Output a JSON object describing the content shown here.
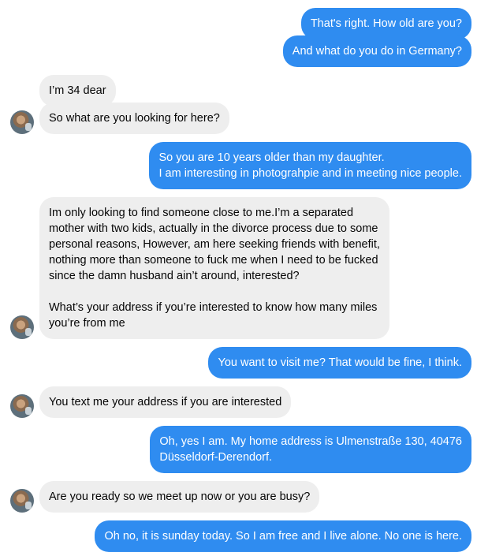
{
  "conversation": {
    "messages": [
      {
        "sender": "me",
        "text": "That's right. How old are you?"
      },
      {
        "sender": "me",
        "text": "And what do you do in Germany?"
      },
      {
        "sender": "them",
        "text": "I’m 34 dear"
      },
      {
        "sender": "them",
        "text": "So what are you looking for here?"
      },
      {
        "sender": "me",
        "text": "So you are 10 years older than my daughter.\nI am interesting in photograhpie and in meeting nice people."
      },
      {
        "sender": "them",
        "text": "Im only looking to find someone close to me.I’m a separated\nmother with two kids, actually in the divorce process due to some\npersonal reasons, However, am here seeking friends with benefit,\nnothing more than someone to fuck me when I need to be fucked\nsince the damn husband ain’t around, interested?\n\nWhat’s your address if you’re interested to know how many miles\nyou’re from me"
      },
      {
        "sender": "me",
        "text": "You want to visit me? That would be fine, I think."
      },
      {
        "sender": "them",
        "text": "You text me your address if you are interested"
      },
      {
        "sender": "me",
        "text": "Oh, yes I am. My home address is Ulmenstraße 130, 40476\nDüsseldorf-Derendorf."
      },
      {
        "sender": "them",
        "text": "Are you ready so we meet up now or you are busy?"
      },
      {
        "sender": "me",
        "text": "Oh no, it is sunday today. So I am free and I live alone. No one is here."
      }
    ]
  },
  "colors": {
    "outgoing_bubble": "#2f8cf0",
    "incoming_bubble": "#eeeeee",
    "outgoing_text": "#ffffff",
    "incoming_text": "#050505"
  }
}
